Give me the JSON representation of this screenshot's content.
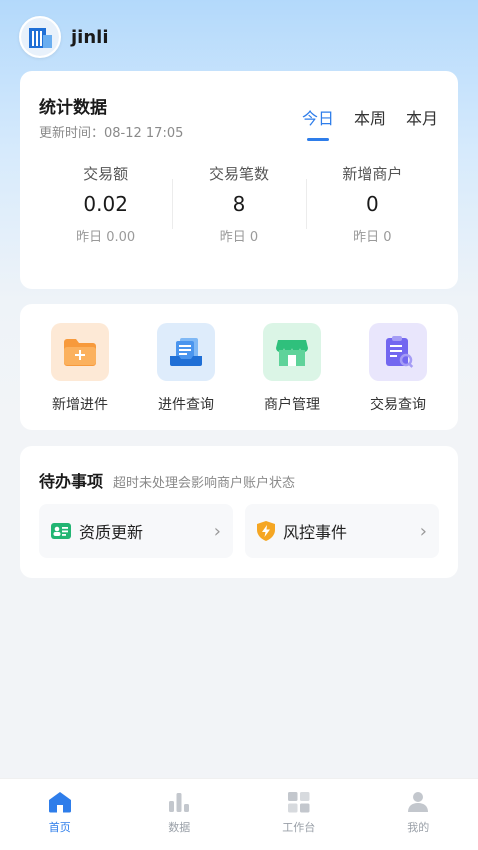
{
  "header": {
    "username": "jinli"
  },
  "stats": {
    "title": "统计数据",
    "updated": "更新时间：08-12 17:05",
    "tabs": [
      {
        "label": "今日",
        "active": true
      },
      {
        "label": "本周"
      },
      {
        "label": "本月"
      }
    ],
    "metrics": [
      {
        "label": "交易额",
        "value": "0.02",
        "prev": "昨日 0.00"
      },
      {
        "label": "交易笔数",
        "value": "8",
        "prev": "昨日 0"
      },
      {
        "label": "新增商户",
        "value": "0",
        "prev": "昨日 0"
      }
    ]
  },
  "actions": [
    {
      "label": "新增进件",
      "icon": "folder-add-icon",
      "color": "#f79a3c"
    },
    {
      "label": "进件查询",
      "icon": "inbox-search-icon",
      "color": "#2e7dea"
    },
    {
      "label": "商户管理",
      "icon": "store-icon",
      "color": "#2fc07c"
    },
    {
      "label": "交易查询",
      "icon": "clipboard-search-icon",
      "color": "#7367f0"
    }
  ],
  "todo": {
    "title": "待办事项",
    "subtitle": "超时未处理会影响商户账户状态",
    "items": [
      {
        "label": "资质更新",
        "icon": "id-card-icon",
        "color": "#22b573"
      },
      {
        "label": "风控事件",
        "icon": "shield-bolt-icon",
        "color": "#f5a623"
      }
    ]
  },
  "tabbar": {
    "items": [
      {
        "label": "首页",
        "icon": "home-icon",
        "active": true
      },
      {
        "label": "数据",
        "icon": "bar-chart-icon"
      },
      {
        "label": "工作台",
        "icon": "grid-icon"
      },
      {
        "label": "我的",
        "icon": "user-icon"
      }
    ]
  },
  "colors": {
    "accent": "#2e7dea",
    "inactive": "#c3c7cd"
  }
}
